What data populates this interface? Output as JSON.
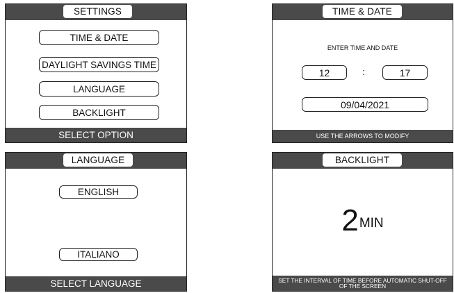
{
  "settings": {
    "title": "SETTINGS",
    "options": [
      "TIME & DATE",
      "DAYLIGHT SAVINGS TIME",
      "LANGUAGE",
      "BACKLIGHT"
    ],
    "footer": "SELECT OPTION"
  },
  "time_date": {
    "title": "TIME & DATE",
    "prompt": "ENTER TIME AND DATE",
    "hour": "12",
    "separator": ":",
    "minute": "17",
    "date": "09/04/2021",
    "footer": "USE THE ARROWS TO MODIFY"
  },
  "language": {
    "title": "LANGUAGE",
    "options": [
      "ENGLISH",
      "ITALIANO"
    ],
    "footer": "SELECT LANGUAGE"
  },
  "backlight": {
    "title": "BACKLIGHT",
    "value": "2",
    "unit": "MIN",
    "footer": "SET THE INTERVAL OF TIME BEFORE AUTOMATIC SHUT-OFF OF THE SCREEN"
  }
}
